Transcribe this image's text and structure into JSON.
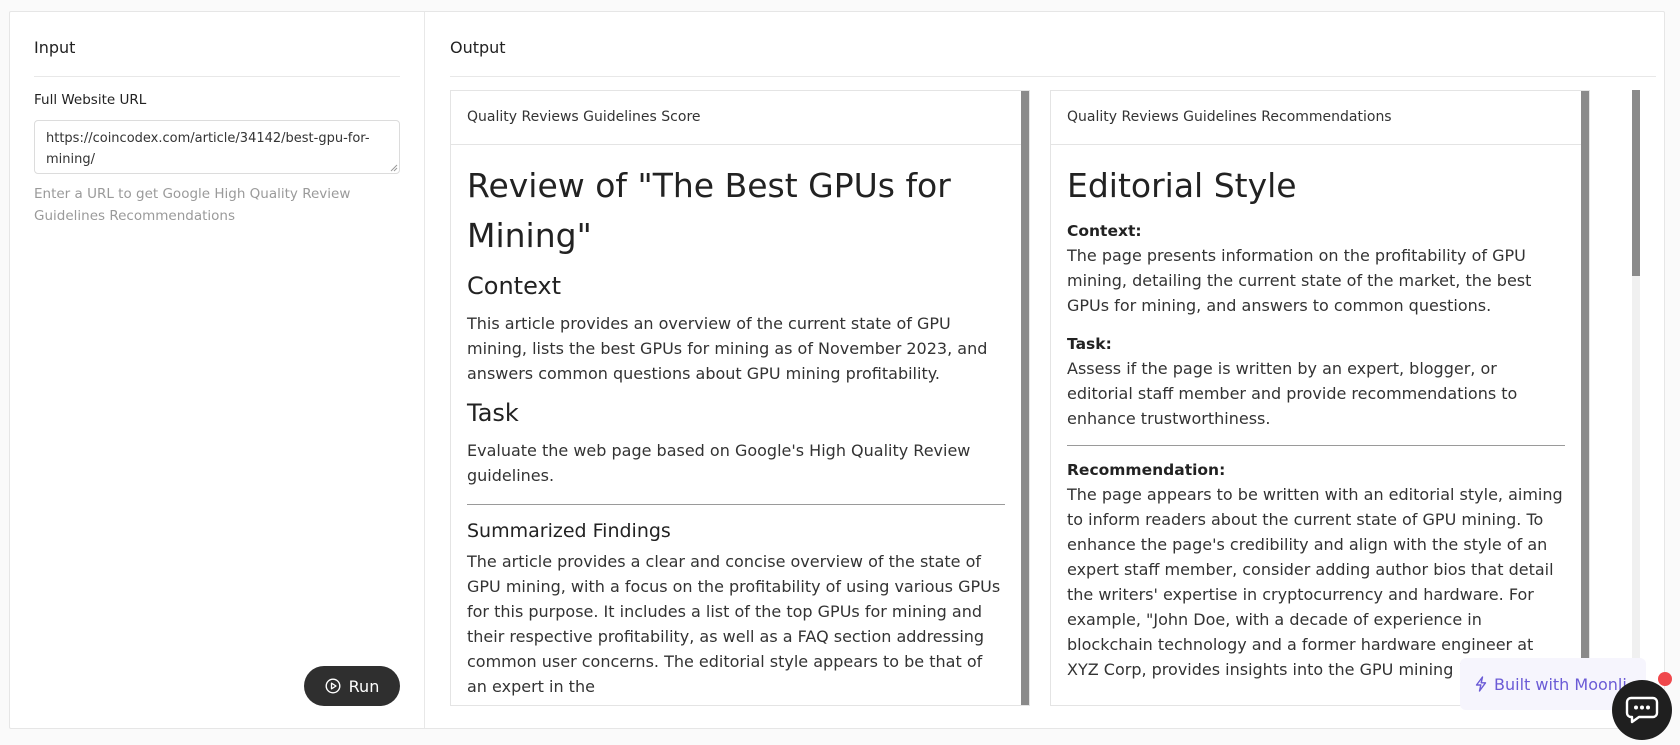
{
  "input": {
    "title": "Input",
    "field_label": "Full Website URL",
    "url_value": "https://coincodex.com/article/34142/best-gpu-for-mining/",
    "helper": "Enter a URL to get Google High Quality Review Guidelines Recommendations",
    "run_label": "Run"
  },
  "output": {
    "title": "Output",
    "score_card": {
      "header": "Quality Reviews Guidelines Score",
      "heading": "Review of \"The Best GPUs for Mining\"",
      "context_heading": "Context",
      "context_text": "This article provides an overview of the current state of GPU mining, lists the best GPUs for mining as of November 2023, and answers common questions about GPU mining profitability.",
      "task_heading": "Task",
      "task_text": "Evaluate the web page based on Google's High Quality Review guidelines.",
      "findings_heading": "Summarized Findings",
      "findings_text": "The article provides a clear and concise overview of the state of GPU mining, with a focus on the profitability of using various GPUs for this purpose. It includes a list of the top GPUs for mining and their respective profitability, as well as a FAQ section addressing common user concerns. The editorial style appears to be that of an expert in the"
    },
    "recommendations_card": {
      "header": "Quality Reviews Guidelines Recommendations",
      "heading": "Editorial Style",
      "context_label": "Context:",
      "context_text": "The page presents information on the profitability of GPU mining, detailing the current state of the market, the best GPUs for mining, and answers to common questions.",
      "task_label": "Task:",
      "task_text": "Assess if the page is written by an expert, blogger, or editorial staff member and provide recommendations to enhance trustworthiness.",
      "recommendation_label": "Recommendation:",
      "recommendation_text": "The page appears to be written with an editorial style, aiming to inform readers about the current state of GPU mining. To enhance the page's credibility and align with the style of an expert staff member, consider adding author bios that detail the writers' expertise in cryptocurrency and hardware. For example, \"John Doe, with a decade of experience in blockchain technology and a former hardware engineer at XYZ Corp, provides insights into the GPU mining landscape.\""
    }
  },
  "footer": {
    "built_with": "Built with Moonli"
  },
  "colors": {
    "run_button": "#2f2f2f",
    "built_with_text": "#6b5bd6",
    "notification_dot": "#f0484c"
  }
}
